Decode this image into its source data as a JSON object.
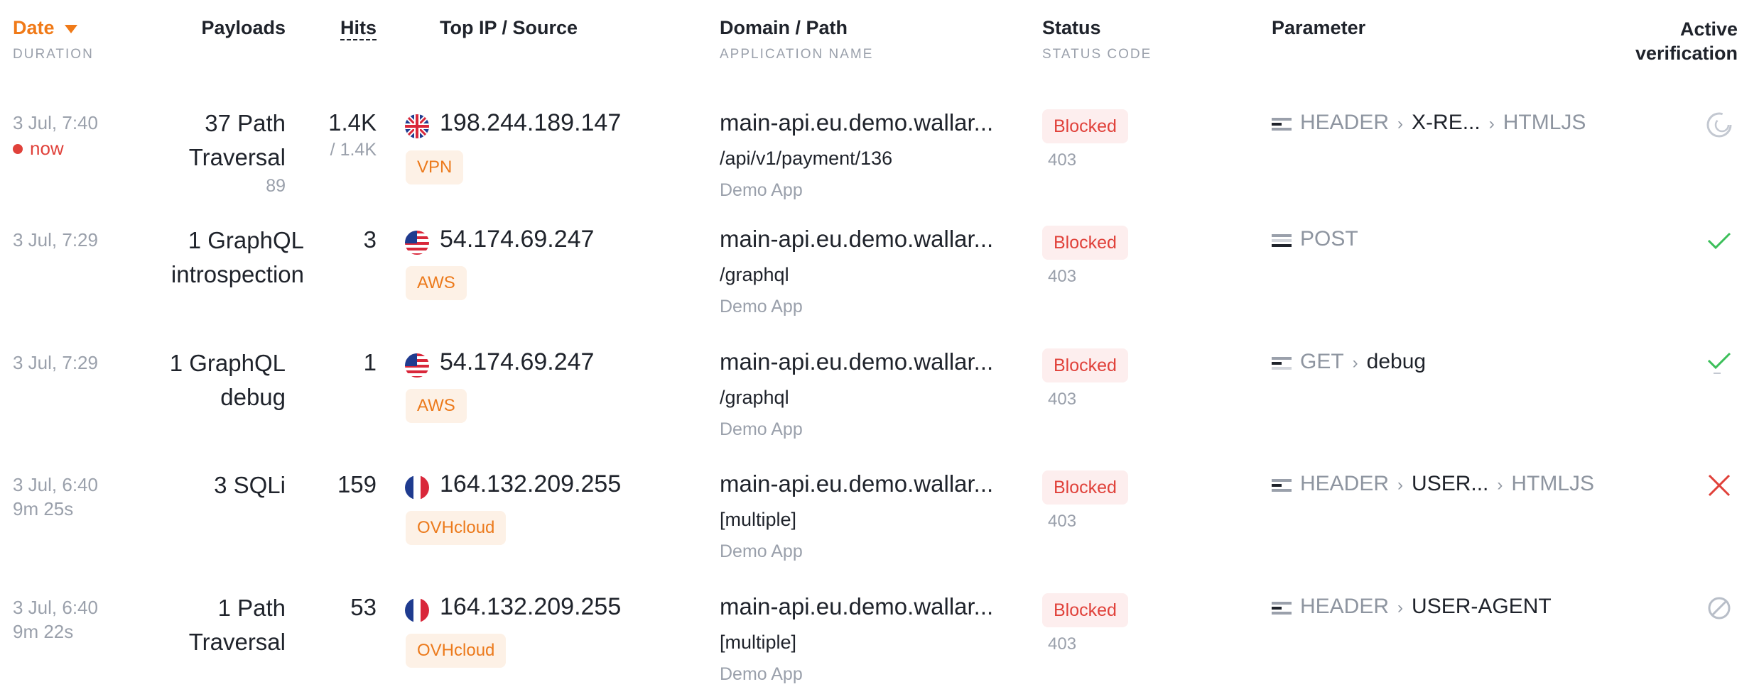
{
  "header": {
    "date": "Date",
    "duration": "DURATION",
    "payloads": "Payloads",
    "hits": "Hits",
    "top_ip": "Top IP / Source",
    "domain": "Domain / Path",
    "application": "APPLICATION NAME",
    "status": "Status",
    "status_code": "STATUS CODE",
    "parameter": "Parameter",
    "active_line1": "Active",
    "active_line2": "verification"
  },
  "rows": [
    {
      "date": "3 Jul, 7:40",
      "duration": "now",
      "payload_line1": "37 Path",
      "payload_line2": "Traversal",
      "payload_sub": "89",
      "hits": "1.4K",
      "hits_sub": "/ 1.4K",
      "flag": "uk-flag-icon",
      "ip": "198.244.189.147",
      "source": "VPN",
      "domain": "main-api.eu.demo.wallar...",
      "path": "/api/v1/payment/136",
      "app": "Demo App",
      "status": "Blocked",
      "code": "403",
      "param": [
        "HEADER",
        "X-RE...",
        "HTMLJS"
      ],
      "verification": "loading-icon"
    },
    {
      "date": "3 Jul, 7:29",
      "duration": "",
      "payload_line1": "1 GraphQL",
      "payload_line2": "introspection",
      "payload_sub": "",
      "hits": "3",
      "hits_sub": "",
      "flag": "us-flag-icon",
      "ip": "54.174.69.247",
      "source": "AWS",
      "domain": "main-api.eu.demo.wallar...",
      "path": "/graphql",
      "app": "Demo App",
      "status": "Blocked",
      "code": "403",
      "param": [
        "POST"
      ],
      "verification": "check-icon"
    },
    {
      "date": "3 Jul, 7:29",
      "duration": "",
      "payload_line1": "1 GraphQL",
      "payload_line2": "debug",
      "payload_sub": "",
      "hits": "1",
      "hits_sub": "",
      "flag": "us-flag-icon",
      "ip": "54.174.69.247",
      "source": "AWS",
      "domain": "main-api.eu.demo.wallar...",
      "path": "/graphql",
      "app": "Demo App",
      "status": "Blocked",
      "code": "403",
      "param": [
        "GET",
        "debug"
      ],
      "verification": "check-icon"
    },
    {
      "date": "3 Jul, 6:40",
      "duration": "9m 25s",
      "payload_line1": "3 SQLi",
      "payload_line2": "",
      "payload_sub": "",
      "hits": "159",
      "hits_sub": "",
      "flag": "fr-flag-icon",
      "ip": "164.132.209.255",
      "source": "OVHcloud",
      "domain": "main-api.eu.demo.wallar...",
      "path": "[multiple]",
      "app": "Demo App",
      "status": "Blocked",
      "code": "403",
      "param": [
        "HEADER",
        "USER...",
        "HTMLJS"
      ],
      "verification": "close-icon"
    },
    {
      "date": "3 Jul, 6:40",
      "duration": "9m 22s",
      "payload_line1": "1 Path",
      "payload_line2": "Traversal",
      "payload_sub": "",
      "hits": "53",
      "hits_sub": "",
      "flag": "fr-flag-icon",
      "ip": "164.132.209.255",
      "source": "OVHcloud",
      "domain": "main-api.eu.demo.wallar...",
      "path": "[multiple]",
      "app": "Demo App",
      "status": "Blocked",
      "code": "403",
      "param": [
        "HEADER",
        "USER-AGENT"
      ],
      "verification": "blocked-icon"
    }
  ]
}
